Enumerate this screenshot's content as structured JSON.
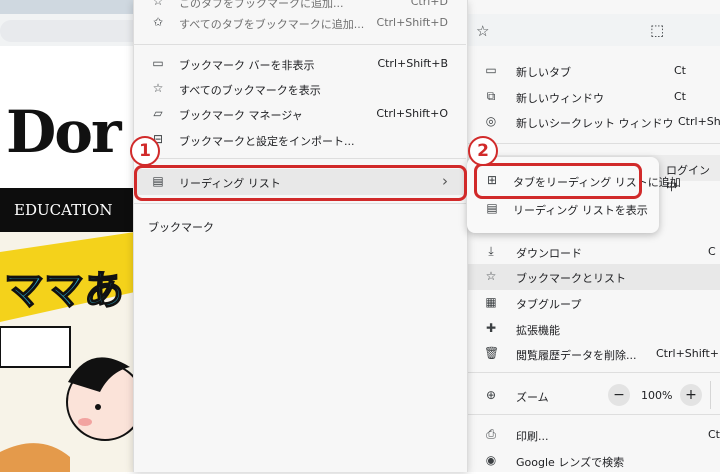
{
  "left_menu": {
    "items": [
      {
        "icon": "star-plus-icon",
        "label": "このタブをブックマークに追加...",
        "shortcut": "Ctrl+D",
        "dim": true
      },
      {
        "icon": "star-multi-icon",
        "label": "すべてのタブをブックマークに追加...",
        "shortcut": "Ctrl+Shift+D",
        "dim": true
      },
      {
        "icon": "bookmark-bar-icon",
        "label": "ブックマーク バーを非表示",
        "shortcut": "Ctrl+Shift+B"
      },
      {
        "icon": "star-icon",
        "label": "すべてのブックマークを表示",
        "shortcut": ""
      },
      {
        "icon": "folder-star-icon",
        "label": "ブックマーク マネージャ",
        "shortcut": "Ctrl+Shift+O"
      },
      {
        "icon": "import-icon",
        "label": "ブックマークと設定をインポート...",
        "shortcut": ""
      }
    ],
    "reading_list": {
      "label": "リーディング リスト",
      "arrow": "›"
    },
    "section_label": "ブックマーク"
  },
  "reading_popup": {
    "add_label": "タブをリーディング リストに追加",
    "show_label": "リーディング リストを表示"
  },
  "right_menu": {
    "items_top": [
      {
        "label": "新しいタブ",
        "shortcut": "Ct"
      },
      {
        "label": "新しいウィンドウ",
        "shortcut": "Ct"
      },
      {
        "label": "新しいシークレット ウィンドウ",
        "shortcut": "Ctrl+Shi"
      }
    ],
    "profile_status": "ログイン中",
    "items_mid": [
      {
        "label": "ダウンロード",
        "shortcut": "C"
      },
      {
        "label": "ブックマークとリスト",
        "shortcut": ""
      },
      {
        "label": "タブグループ",
        "shortcut": ""
      },
      {
        "label": "拡張機能",
        "shortcut": ""
      },
      {
        "label": "閲覧履歴データを削除...",
        "shortcut": "Ctrl+Shift+De"
      }
    ],
    "zoom": {
      "label": "ズーム",
      "minus": "−",
      "value": "100%",
      "plus": "+"
    },
    "items_bottom": [
      {
        "label": "印刷...",
        "shortcut": "Ct"
      },
      {
        "label": "Google レンズで検索",
        "shortcut": ""
      }
    ]
  },
  "page": {
    "logo_text": "Dor",
    "nav_text": "EDUCATION",
    "illus_text": "ママあ"
  },
  "annotations": {
    "step1": "1",
    "step2": "2"
  },
  "colors": {
    "annotation_red": "#d12a2a",
    "menu_bg": "#f7f7f7",
    "highlight": "#e8e8e8"
  }
}
